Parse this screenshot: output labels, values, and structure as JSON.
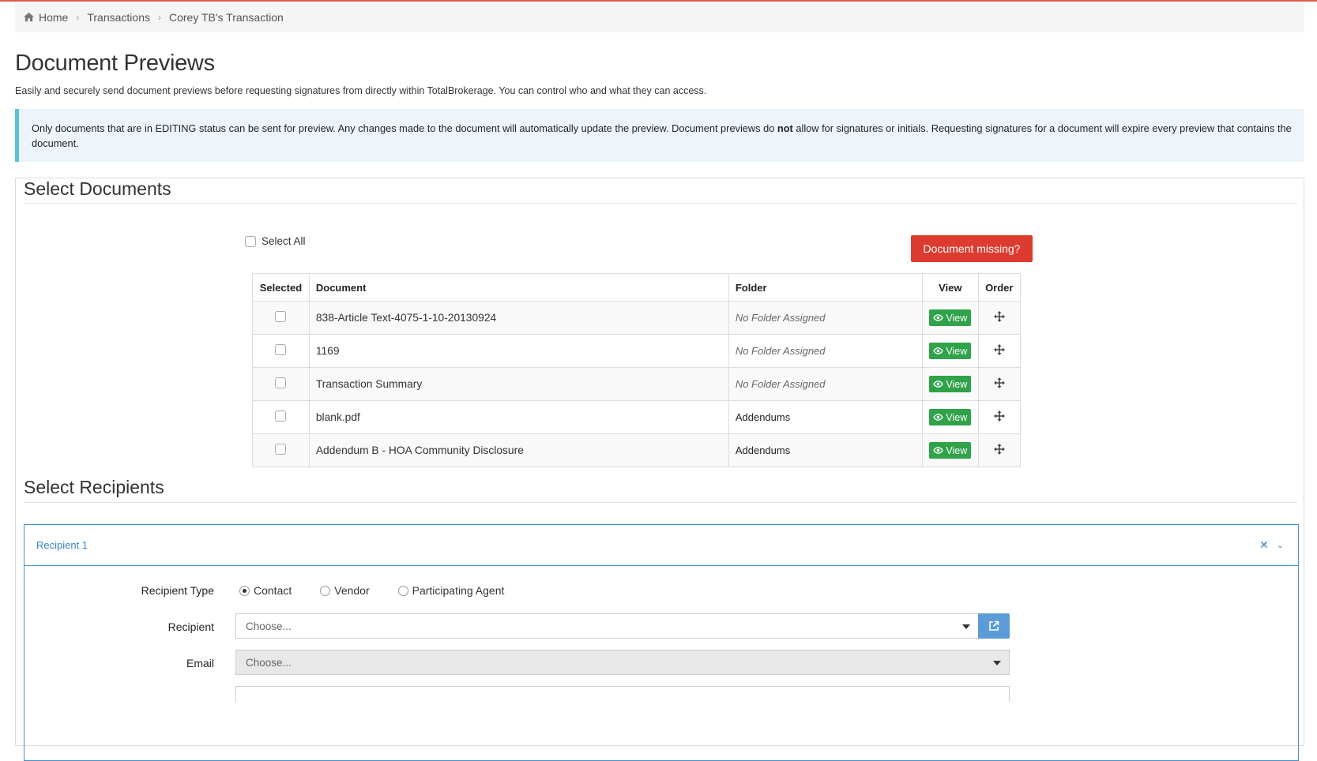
{
  "breadcrumb": {
    "home": "Home",
    "transactions": "Transactions",
    "current": "Corey TB's Transaction"
  },
  "page": {
    "title": "Document Previews",
    "subtitle": "Easily and securely send document previews before requesting signatures from directly within TotalBrokerage. You can control who and what they can access."
  },
  "info": {
    "part1": "Only documents that are in EDITING status can be sent for preview. Any changes made to the document will automatically update the preview. Document previews do ",
    "bold": "not",
    "part2": " allow for signatures or initials. Requesting signatures for a document will expire every preview that contains the document."
  },
  "documents_section": {
    "title": "Select Documents",
    "select_all_label": "Select All",
    "missing_button": "Document missing?",
    "columns": {
      "selected": "Selected",
      "document": "Document",
      "folder": "Folder",
      "view": "View",
      "order": "Order"
    },
    "view_label": "View",
    "rows": [
      {
        "document": "838-Article Text-4075-1-10-20130924",
        "folder": "No Folder Assigned"
      },
      {
        "document": "1169",
        "folder": "No Folder Assigned"
      },
      {
        "document": "Transaction Summary",
        "folder": "No Folder Assigned"
      },
      {
        "document": "blank.pdf",
        "folder": "Addendums"
      },
      {
        "document": "Addendum B - HOA Community Disclosure",
        "folder": "Addendums"
      }
    ]
  },
  "recipients_section": {
    "title": "Select Recipients",
    "card_title": "Recipient 1",
    "type_label": "Recipient Type",
    "types": [
      "Contact",
      "Vendor",
      "Participating Agent"
    ],
    "selected_type": "Contact",
    "recipient_label": "Recipient",
    "recipient_placeholder": "Choose...",
    "email_label": "Email",
    "email_placeholder": "Choose..."
  },
  "colors": {
    "view_button": "#2fa24a",
    "missing_button": "#dd3b30",
    "card_border": "#4a90c8",
    "info_bar": "#5bc0de"
  }
}
